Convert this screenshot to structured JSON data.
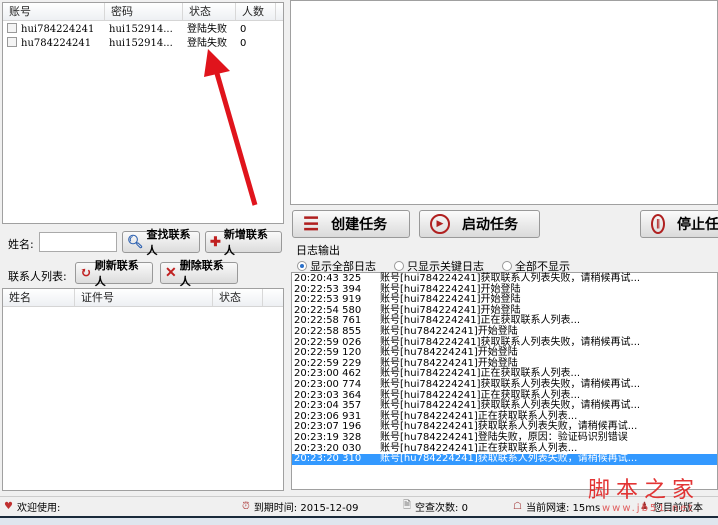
{
  "accounts": {
    "headers": [
      "账号",
      "密码",
      "状态",
      "人数"
    ],
    "rows": [
      [
        "hui784224241",
        "hui152914...",
        "登陆失败",
        "0"
      ],
      [
        "hu784224241",
        "hui152914...",
        "登陆失败",
        "0"
      ]
    ]
  },
  "contact_search": {
    "name_label": "姓名:",
    "name_value": "",
    "find_label": "查找联系人",
    "add_label": "新增联系人"
  },
  "contact_list": {
    "label": "联系人列表:",
    "refresh_label": "刷新联系人",
    "delete_label": "删除联系人",
    "headers": [
      "姓名",
      "证件号",
      "状态"
    ]
  },
  "tasks": {
    "create_label": "创建任务",
    "start_label": "启动任务",
    "stop_label": "停止任"
  },
  "log": {
    "title": "日志输出",
    "radios": [
      {
        "label": "显示全部日志",
        "checked": true
      },
      {
        "label": "只显示关键日志",
        "checked": false
      },
      {
        "label": "全部不显示",
        "checked": false
      }
    ],
    "entries": [
      [
        "20:20:43 325",
        "账号[hui784224241]获取联系人列表失败，请稍候再试..."
      ],
      [
        "20:22:53 394",
        "账号[hui784224241]开始登陆"
      ],
      [
        "20:22:53 919",
        "账号[hui784224241]开始登陆"
      ],
      [
        "20:22:54 580",
        "账号[hui784224241]开始登陆"
      ],
      [
        "20:22:58 761",
        "账号[hui784224241]正在获取联系人列表..."
      ],
      [
        "20:22:58 855",
        "账号[hu784224241]开始登陆"
      ],
      [
        "20:22:59 026",
        "账号[hui784224241]获取联系人列表失败，请稍候再试..."
      ],
      [
        "20:22:59 120",
        "账号[hu784224241]开始登陆"
      ],
      [
        "20:22:59 229",
        "账号[hu784224241]开始登陆"
      ],
      [
        "20:23:00 462",
        "账号[hui784224241]正在获取联系人列表..."
      ],
      [
        "20:23:00 774",
        "账号[hui784224241]获取联系人列表失败，请稍候再试..."
      ],
      [
        "20:23:03 364",
        "账号[hui784224241]正在获取联系人列表..."
      ],
      [
        "20:23:04 357",
        "账号[hui784224241]获取联系人列表失败，请稍候再试..."
      ],
      [
        "20:23:06 931",
        "账号[hu784224241]正在获取联系人列表..."
      ],
      [
        "20:23:07 196",
        "账号[hu784224241]获取联系人列表失败，请稍候再试..."
      ],
      [
        "20:23:19 328",
        "账号[hu784224241]登陆失败，原因：验证码识别错误"
      ],
      [
        "20:23:20 030",
        "账号[hu784224241]正在获取联系人列表..."
      ],
      [
        "20:23:20 310",
        "账号[hu784224241]获取联系人列表失败，请稍候再试..."
      ]
    ],
    "selected_index": 17
  },
  "status": {
    "welcome": "欢迎使用:",
    "expire": "到期时间: 2015-12-09",
    "empty_checks": "空查次数: 0",
    "speed": "当前网速: 15ms",
    "version": "您目前版本"
  },
  "watermark": {
    "title": "脚本之家",
    "url": "www.jb51.net"
  },
  "colors": {
    "accent": "#b02020",
    "selection": "#3399ff",
    "arrow": "#e0141c"
  }
}
